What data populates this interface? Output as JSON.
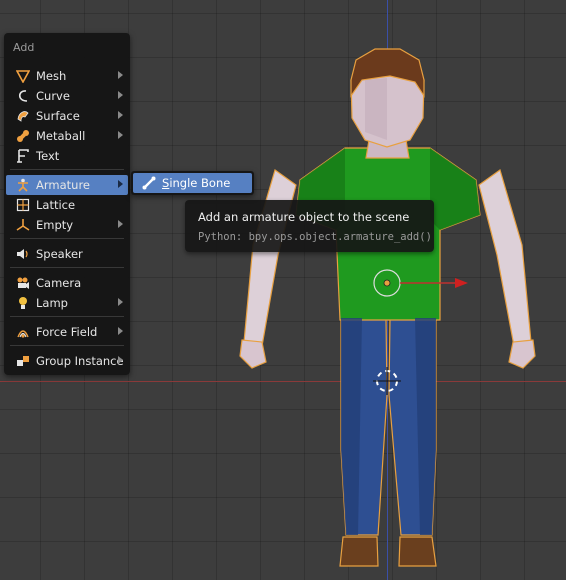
{
  "menu": {
    "title": "Add",
    "items": [
      {
        "label": "Mesh",
        "icon": "mesh-icon",
        "submenu": true
      },
      {
        "label": "Curve",
        "icon": "curve-icon",
        "submenu": true
      },
      {
        "label": "Surface",
        "icon": "surface-icon",
        "submenu": true
      },
      {
        "label": "Metaball",
        "icon": "metaball-icon",
        "submenu": true
      },
      {
        "label": "Text",
        "icon": "text-icon",
        "submenu": false
      },
      {
        "label": "Armature",
        "icon": "armature-icon",
        "submenu": true,
        "active": true
      },
      {
        "label": "Lattice",
        "icon": "lattice-icon",
        "submenu": false
      },
      {
        "label": "Empty",
        "icon": "empty-icon",
        "submenu": true
      },
      {
        "label": "Speaker",
        "icon": "speaker-icon",
        "submenu": false
      },
      {
        "label": "Camera",
        "icon": "camera-icon",
        "submenu": false
      },
      {
        "label": "Lamp",
        "icon": "lamp-icon",
        "submenu": true
      },
      {
        "label": "Force Field",
        "icon": "force-field-icon",
        "submenu": true
      },
      {
        "label": "Group Instance",
        "icon": "group-instance-icon",
        "submenu": true
      }
    ]
  },
  "submenu": {
    "items": [
      {
        "label": "Single Bone",
        "icon": "bone-icon"
      }
    ]
  },
  "tooltip": {
    "title": "Add an armature object to the scene",
    "python": "Python: bpy.ops.object.armature_add()"
  },
  "colors": {
    "viewport_bg": "#3d3d3d",
    "menu_bg": "#141414",
    "highlight": "#5680c2",
    "x_axis": "#8a3a3a",
    "z_axis": "#3a4fa8",
    "selection_outline": "#e8a040",
    "shirt": "#1f9a1f",
    "jeans": "#2e4f92",
    "skin": "#d8c5cf",
    "hair": "#6b3a1c"
  }
}
